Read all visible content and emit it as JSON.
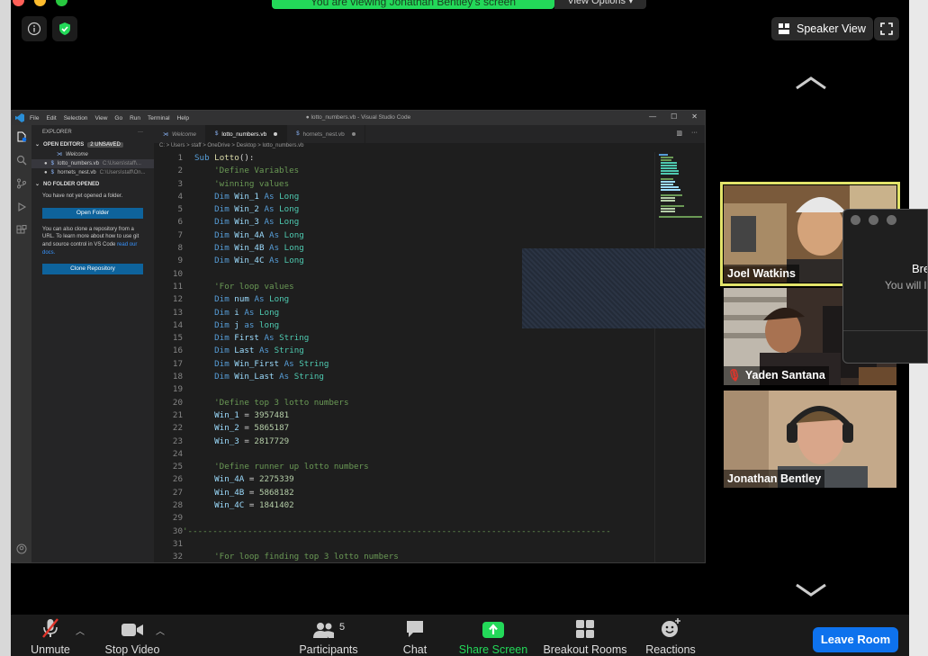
{
  "meeting": {
    "share_banner": "You are viewing Jonathan Bentley's screen",
    "view_options": "View Options ▾",
    "speaker_view": "Speaker View"
  },
  "vscode": {
    "title": "● lotto_numbers.vb - Visual Studio Code",
    "menu": [
      "File",
      "Edit",
      "Selection",
      "View",
      "Go",
      "Run",
      "Terminal",
      "Help"
    ],
    "sidebar": {
      "header": "EXPLORER",
      "open_editors": "OPEN EDITORS",
      "unsaved": "2 UNSAVED",
      "items": [
        {
          "name": "Welcome",
          "path": ""
        },
        {
          "name": "lotto_numbers.vb",
          "path": "C:\\Users\\staff\\..."
        },
        {
          "name": "hornets_nest.vb",
          "path": "C:\\Users\\staff\\On..."
        }
      ],
      "no_folder": "NO FOLDER OPENED",
      "no_folder_text": "You have not yet opened a folder.",
      "open_folder": "Open Folder",
      "clone_text": "You can also clone a repository from a URL. To learn more about how to use git and source control in VS Code",
      "read_docs": "read our docs.",
      "clone_button": "Clone Repository"
    },
    "tabs": [
      {
        "label": "Welcome"
      },
      {
        "label": "lotto_numbers.vb"
      },
      {
        "label": "hornets_nest.vb"
      }
    ],
    "breadcrumb": "C: > Users > staff > OneDrive > Desktop > lotto_numbers.vb"
  },
  "participants_tiles": [
    {
      "name": "Joel Watkins"
    },
    {
      "name": "Yaden Santana"
    },
    {
      "name": "Jonathan Bentley"
    }
  ],
  "dialog": {
    "title": "Bre",
    "subtitle": "You will l"
  },
  "toolbar": {
    "unmute": "Unmute",
    "stop_video": "Stop Video",
    "participants": "Participants",
    "participants_count": "5",
    "chat": "Chat",
    "share_screen": "Share Screen",
    "breakout_rooms": "Breakout Rooms",
    "reactions": "Reactions",
    "leave": "Leave Room"
  },
  "colors": {
    "share_green": "#23d959",
    "leave_blue": "#0e72ed",
    "active_speaker": "#e2e36a"
  }
}
